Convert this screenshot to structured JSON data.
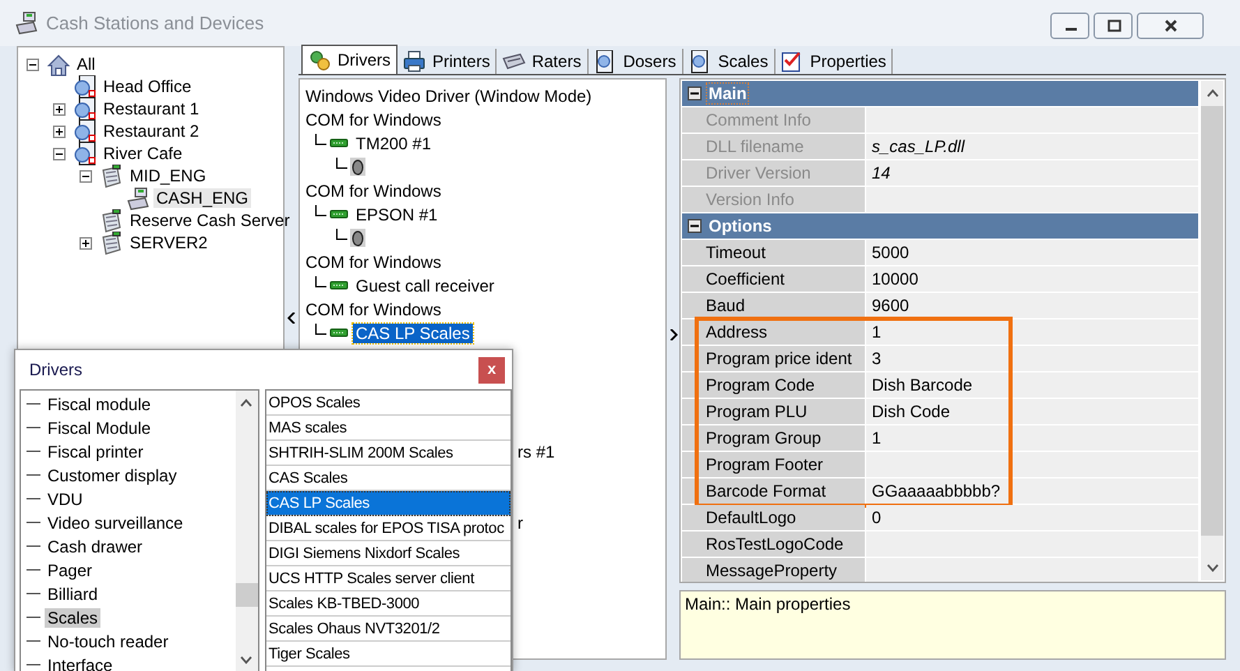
{
  "window": {
    "title": "Cash Stations and Devices"
  },
  "window_controls": [
    {
      "kind": "minimize"
    },
    {
      "kind": "maximize"
    },
    {
      "kind": "close"
    }
  ],
  "tree": [
    {
      "label": "All",
      "kind": "home",
      "expanded": true,
      "selected": false,
      "children": [
        {
          "label": "Head Office",
          "kind": "group",
          "selected": false
        },
        {
          "label": "Restaurant 1",
          "kind": "group",
          "expanded": false,
          "selected": false
        },
        {
          "label": "Restaurant 2",
          "kind": "group",
          "expanded": false,
          "selected": false
        },
        {
          "label": "River Cafe",
          "kind": "group",
          "expanded": true,
          "selected": false,
          "children": [
            {
              "label": "MID_ENG",
              "kind": "server",
              "expanded": true,
              "selected": false,
              "children": [
                {
                  "label": "CASH_ENG",
                  "kind": "register",
                  "selected": true
                }
              ]
            },
            {
              "label": "Reserve Cash Server",
              "kind": "server",
              "selected": false
            },
            {
              "label": "SERVER2",
              "kind": "server",
              "expanded": false,
              "selected": false
            }
          ]
        }
      ]
    }
  ],
  "tabs": [
    {
      "label": "Drivers",
      "kind": "gears",
      "selected": true
    },
    {
      "label": "Printers",
      "kind": "printer",
      "selected": false
    },
    {
      "label": "Raters",
      "kind": "reader",
      "selected": false
    },
    {
      "label": "Dosers",
      "kind": "cube",
      "selected": false
    },
    {
      "label": "Scales",
      "kind": "cube",
      "selected": false
    },
    {
      "label": "Properties",
      "kind": "checklist",
      "selected": false
    }
  ],
  "drivers": [
    {
      "label": "Windows Video Driver (Window Mode)",
      "kind": "driver",
      "selected": false
    },
    {
      "label": "COM for Windows",
      "kind": "driver",
      "selected": false,
      "children": [
        {
          "label": "TM200 #1",
          "kind": "device",
          "selected": false,
          "children": [
            {
              "kind": "mouse"
            }
          ]
        }
      ]
    },
    {
      "label": "COM for Windows",
      "kind": "driver",
      "selected": false,
      "children": [
        {
          "label": "EPSON #1",
          "kind": "device",
          "selected": false,
          "children": [
            {
              "kind": "mouse"
            }
          ]
        }
      ]
    },
    {
      "label": "COM for Windows",
      "kind": "driver",
      "selected": false,
      "children": [
        {
          "label": "Guest call receiver",
          "kind": "device",
          "selected": false
        }
      ]
    },
    {
      "label": "COM for Windows",
      "kind": "driver",
      "selected": false,
      "children": [
        {
          "label": "CAS LP Scales",
          "kind": "device",
          "selected": true
        }
      ]
    },
    {
      "label": "rs #1",
      "kind": "fragment"
    },
    {
      "label": "r",
      "kind": "fragment"
    }
  ],
  "properties": [
    {
      "label": "Main",
      "expanded": true,
      "rows": [
        {
          "name": "Comment Info",
          "readonly": true,
          "highlighted": false
        },
        {
          "name": "DLL filename",
          "value": "s_cas_LP.dll",
          "readonly": true,
          "highlighted": false
        },
        {
          "name": "Driver Version",
          "value": "14",
          "readonly": true,
          "highlighted": false
        },
        {
          "name": "Version Info",
          "readonly": true,
          "highlighted": false
        }
      ]
    },
    {
      "label": "Options",
      "expanded": true,
      "rows": [
        {
          "name": "Timeout",
          "value": "5000",
          "readonly": false,
          "highlighted": false
        },
        {
          "name": "Coefficient",
          "value": "10000",
          "readonly": false,
          "highlighted": false
        },
        {
          "name": "Baud",
          "value": "9600",
          "readonly": false,
          "highlighted": false
        },
        {
          "name": "Address",
          "value": "1",
          "readonly": false,
          "highlighted": true
        },
        {
          "name": "Program price ident",
          "value": "3",
          "readonly": false,
          "highlighted": true
        },
        {
          "name": "Program Code",
          "value": "Dish Barcode",
          "readonly": false,
          "highlighted": true
        },
        {
          "name": "Program PLU",
          "value": "Dish Code",
          "readonly": false,
          "highlighted": true
        },
        {
          "name": "Program Group",
          "value": "1",
          "readonly": false,
          "highlighted": true
        },
        {
          "name": "Program Footer",
          "readonly": false,
          "highlighted": true
        },
        {
          "name": "Barcode Format",
          "value": "GGaaaaabbbbb?",
          "readonly": false,
          "highlighted": true
        },
        {
          "name": "DefaultLogo",
          "value": "0",
          "readonly": false,
          "highlighted": false
        },
        {
          "name": "RosTestLogoCode",
          "readonly": false,
          "highlighted": false
        },
        {
          "name": "MessageProperty",
          "readonly": false,
          "highlighted": false
        }
      ]
    }
  ],
  "description": "Main:: Main properties",
  "dialog": {
    "title": "Drivers",
    "close": "x",
    "categories": [
      {
        "label": "Fiscal module",
        "selected": false
      },
      {
        "label": "Fiscal Module",
        "selected": false
      },
      {
        "label": "Fiscal printer",
        "selected": false
      },
      {
        "label": "Customer display",
        "selected": false
      },
      {
        "label": "VDU",
        "selected": false
      },
      {
        "label": "Video surveillance",
        "selected": false
      },
      {
        "label": "Cash drawer",
        "selected": false
      },
      {
        "label": "Pager",
        "selected": false
      },
      {
        "label": "Billiard",
        "selected": false
      },
      {
        "label": "Scales",
        "selected": true
      },
      {
        "label": "No-touch reader",
        "selected": false
      },
      {
        "label": "Interface",
        "selected": false
      }
    ],
    "drivers": [
      {
        "label": "OPOS Scales",
        "selected": false
      },
      {
        "label": "MAS scales",
        "selected": false
      },
      {
        "label": "SHTRIH-SLIM 200M Scales",
        "selected": false
      },
      {
        "label": "CAS Scales",
        "selected": false
      },
      {
        "label": "CAS LP Scales",
        "selected": true
      },
      {
        "label": "DIBAL scales for EPOS TISA protoc",
        "selected": false
      },
      {
        "label": "DIGI Siemens Nixdorf Scales",
        "selected": false
      },
      {
        "label": "UCS HTTP Scales server client",
        "selected": false
      },
      {
        "label": "Scales KB-TBED-3000",
        "selected": false
      },
      {
        "label": "Scales Ohaus NVT3201/2",
        "selected": false
      },
      {
        "label": "Tiger Scales",
        "selected": false
      }
    ]
  }
}
